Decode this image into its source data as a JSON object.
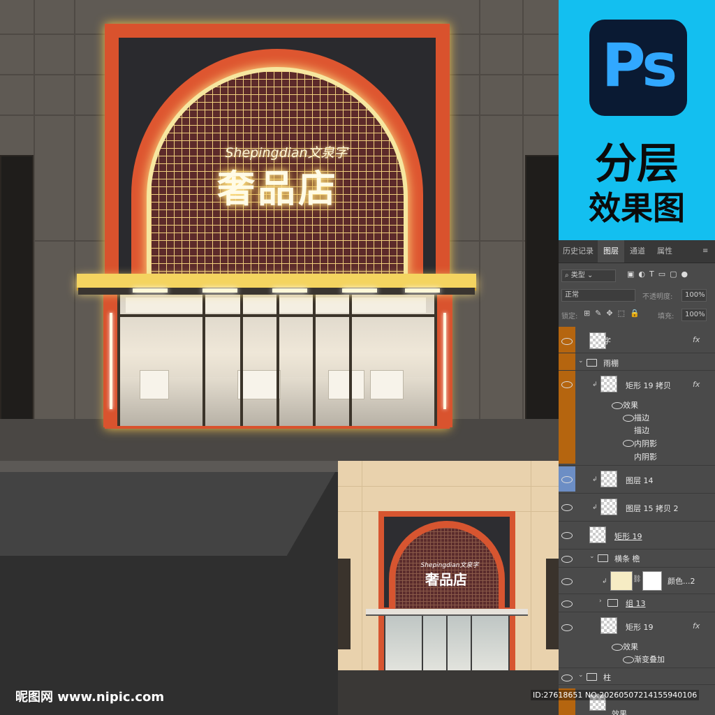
{
  "storefront": {
    "sign_small": "Shepingdian文泉字",
    "sign_big": "奢品店"
  },
  "thumbnail": {
    "sign_small": "Shepingdian文泉字",
    "sign_big": "奢品店"
  },
  "badge": {
    "logo_text": "Ps",
    "title_line1": "分层",
    "title_line2": "效果图",
    "colors": {
      "background": "#13bff0",
      "logo_bg": "#0a1a33",
      "logo_text": "#31a8ff"
    }
  },
  "ps_panel": {
    "tabs": [
      "历史记录",
      "图层",
      "通道",
      "属性"
    ],
    "active_tab": "图层",
    "filter_label": "类型",
    "blend_mode": "正常",
    "opacity_label": "不透明度:",
    "opacity_value": "100%",
    "lock_label": "锁定:",
    "fill_label": "填充:",
    "fill_value": "100%",
    "layers": [
      {
        "name": "字",
        "fx": "fx",
        "kind": "layer"
      },
      {
        "name": "雨棚",
        "kind": "group"
      },
      {
        "name": "矩形 19 拷贝",
        "fx": "fx",
        "kind": "layer"
      },
      {
        "name": "效果",
        "kind": "effect"
      },
      {
        "name": "描边",
        "kind": "effect"
      },
      {
        "name": "描边",
        "kind": "effect"
      },
      {
        "name": "内阴影",
        "kind": "effect"
      },
      {
        "name": "内阴影",
        "kind": "effect"
      },
      {
        "name": "图层 14",
        "kind": "layer"
      },
      {
        "name": "图层 15 拷贝 2",
        "kind": "layer"
      },
      {
        "name": "矩形 19",
        "kind": "layer"
      },
      {
        "name": "横条 檐",
        "kind": "group"
      },
      {
        "name": "颜色...2",
        "kind": "adjustment"
      },
      {
        "name": "组 13",
        "kind": "group"
      },
      {
        "name": "矩形 19",
        "fx": "fx",
        "kind": "layer"
      },
      {
        "name": "效果",
        "kind": "effect"
      },
      {
        "name": "渐变叠加",
        "kind": "effect"
      },
      {
        "name": "柱",
        "kind": "group"
      },
      {
        "name": "效果",
        "kind": "effect"
      }
    ]
  },
  "watermark": {
    "left": "昵图网 www.nipic.com",
    "right": "ID:27618651 NO:20260507214155940106"
  }
}
